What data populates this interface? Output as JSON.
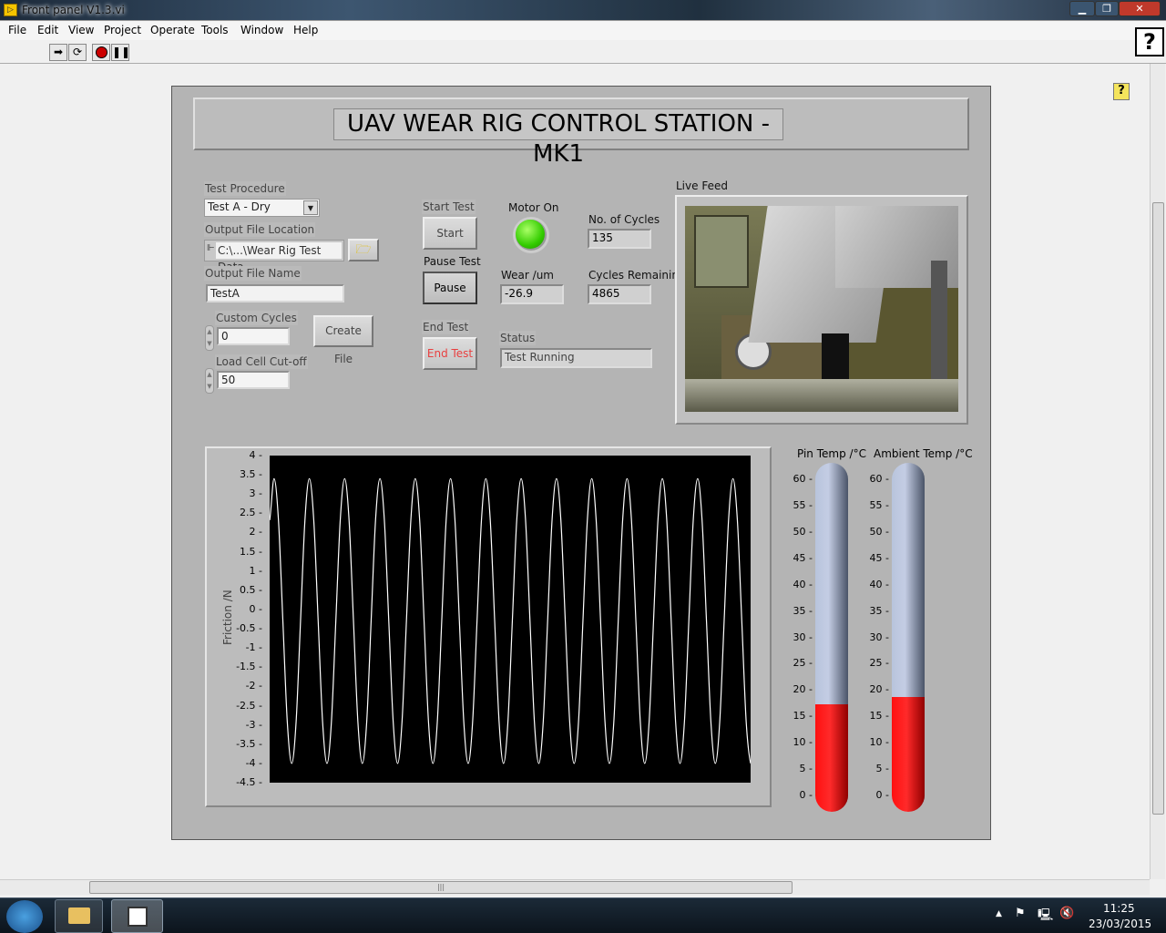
{
  "window": {
    "title": "Front panel V1.3.vi",
    "app_icon": "labview-vi-icon"
  },
  "menu": [
    "File",
    "Edit",
    "View",
    "Project",
    "Operate",
    "Tools",
    "Window",
    "Help"
  ],
  "toolbar": {
    "buttons": [
      "run-arrow-icon",
      "run-continuously-icon",
      "abort-icon",
      "pause-icon"
    ],
    "help": "?"
  },
  "panel": {
    "title": "UAV WEAR RIG CONTROL STATION - MK1",
    "test_procedure": {
      "label": "Test Procedure",
      "value": "Test A - Dry"
    },
    "output_location": {
      "label": "Output File Location",
      "value": "C:\\...\\Wear Rig Test Data"
    },
    "output_name": {
      "label": "Output File Name",
      "value": "TestA"
    },
    "custom_cycles": {
      "label": "Custom Cycles",
      "value": "0"
    },
    "load_cell": {
      "label": "Load Cell Cut-off",
      "value": "50"
    },
    "create_file": "Create File",
    "start": {
      "label": "Start Test",
      "button": "Start"
    },
    "pause": {
      "label": "Pause Test",
      "button": "Pause"
    },
    "end": {
      "label": "End Test",
      "button": "End Test"
    },
    "motor": {
      "label": "Motor On",
      "on": true,
      "color": "#33cc00"
    },
    "cycles": {
      "label": "No. of Cycles",
      "value": "135"
    },
    "wear": {
      "label": "Wear /um",
      "value": "-26.9"
    },
    "remaining": {
      "label": "Cycles Remaining",
      "value": "4865"
    },
    "status": {
      "label": "Status",
      "value": "Test Running"
    },
    "live_feed": {
      "label": "Live Feed"
    },
    "pin_temp": {
      "label": "Pin Temp /°C",
      "value": 17.3,
      "ticks": [
        "60",
        "55",
        "50",
        "45",
        "40",
        "35",
        "30",
        "25",
        "20",
        "15",
        "10",
        "5",
        "0"
      ]
    },
    "ambient_temp": {
      "label": "Ambient Temp /°C",
      "value": 18.6,
      "ticks": [
        "60",
        "55",
        "50",
        "45",
        "40",
        "35",
        "30",
        "25",
        "20",
        "15",
        "10",
        "5",
        "0"
      ]
    }
  },
  "chart_data": {
    "type": "line",
    "ylabel": "Friction /N",
    "ylim": [
      -4.5,
      4
    ],
    "yticks": [
      "4",
      "3.5",
      "3",
      "2.5",
      "2",
      "1.5",
      "1",
      "0.5",
      "0",
      "-0.5",
      "-1",
      "-1.5",
      "-2",
      "-2.5",
      "-3",
      "-3.5",
      "-4",
      "-4.5"
    ],
    "grid": false,
    "line_color": "#ffffff",
    "background": "#000000",
    "values": [
      2.32,
      3.4,
      2.32,
      -0.3,
      -2.92,
      -4.0,
      -2.92,
      -0.3,
      2.32,
      3.4,
      2.32,
      -0.3,
      -2.92,
      -4.0,
      -2.92,
      -0.3,
      2.32,
      3.4,
      2.32,
      -0.3,
      -2.92,
      -4.0,
      -2.92,
      -0.3,
      2.32,
      3.4,
      2.32,
      -0.3,
      -2.92,
      -4.0,
      -2.92,
      -0.3,
      2.32,
      3.4,
      2.32,
      -0.3,
      -2.92,
      -4.0,
      -2.92,
      -0.3,
      2.32,
      3.4,
      2.32,
      -0.3,
      -2.92,
      -4.0,
      -2.92,
      -0.3,
      2.32,
      3.4,
      2.32,
      -0.3,
      -2.92,
      -4.0,
      -2.92,
      -0.3,
      2.32,
      3.4,
      2.32,
      -0.3,
      -2.92,
      -4.0,
      -2.92,
      -0.3,
      2.32,
      3.4,
      2.32,
      -0.3,
      -2.92,
      -4.0,
      -2.92,
      -0.3,
      2.32,
      3.4,
      2.32,
      -0.3,
      -2.92,
      -4.0,
      -2.92,
      -0.3,
      2.32,
      3.4,
      2.32,
      -0.3,
      -2.92,
      -4.0,
      -2.92,
      -0.3,
      2.32,
      3.4,
      2.32,
      -0.3,
      -2.92,
      -4.0,
      -2.92,
      -0.3,
      2.32,
      3.4,
      2.32,
      -0.3,
      -2.92,
      -4.0,
      -2.92,
      -0.3,
      2.32,
      3.4,
      2.32,
      -0.3,
      -2.92,
      -4.0
    ]
  },
  "taskbar": {
    "time": "11:25",
    "date": "23/03/2015",
    "apps": [
      "explorer-icon",
      "labview-window-icon"
    ],
    "tray": [
      "show-hidden-icon",
      "action-center-flag-icon",
      "network-icon",
      "volume-muted-icon"
    ]
  }
}
